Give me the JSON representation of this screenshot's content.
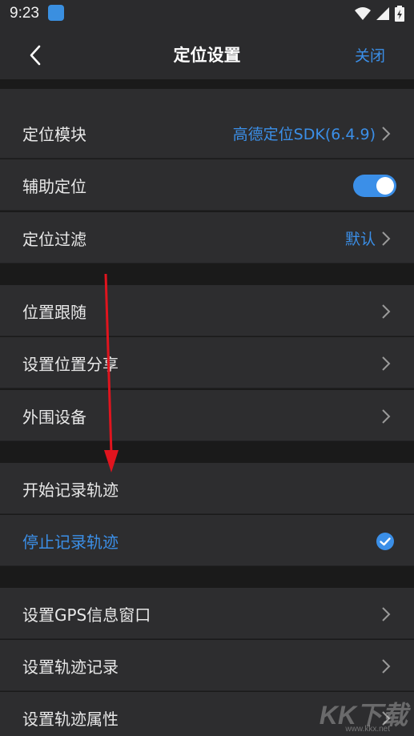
{
  "status_bar": {
    "time": "9:23",
    "icons": [
      "app-notification-icon",
      "wifi-icon",
      "signal-icon",
      "battery-charging-icon"
    ]
  },
  "header": {
    "title": "定位设置",
    "close_label": "关闭",
    "back_icon": "chevron-left-icon"
  },
  "groups": [
    {
      "items": [
        {
          "label": "定位模块",
          "value": "高德定位SDK(6.4.9)",
          "control": "chevron"
        },
        {
          "label": "辅助定位",
          "control": "toggle",
          "enabled": true
        },
        {
          "label": "定位过滤",
          "value": "默认",
          "control": "chevron"
        }
      ]
    },
    {
      "items": [
        {
          "label": "位置跟随",
          "control": "chevron"
        },
        {
          "label": "设置位置分享",
          "control": "chevron"
        },
        {
          "label": "外围设备",
          "control": "chevron"
        }
      ]
    },
    {
      "items": [
        {
          "label": "开始记录轨迹",
          "control": "none"
        },
        {
          "label": "停止记录轨迹",
          "control": "check",
          "selected": true
        }
      ]
    },
    {
      "items": [
        {
          "label": "设置GPS信息窗口",
          "control": "chevron"
        },
        {
          "label": "设置轨迹记录",
          "control": "chevron"
        },
        {
          "label": "设置轨迹属性",
          "control": "chevron"
        }
      ]
    }
  ],
  "watermark": {
    "text": "KK下载",
    "subtext": "www.kkx.net"
  },
  "colors": {
    "accent": "#3b8fe8",
    "row_bg": "#2d2d2f",
    "page_bg": "#1a1a1a",
    "annotation_arrow": "#e0141e"
  }
}
